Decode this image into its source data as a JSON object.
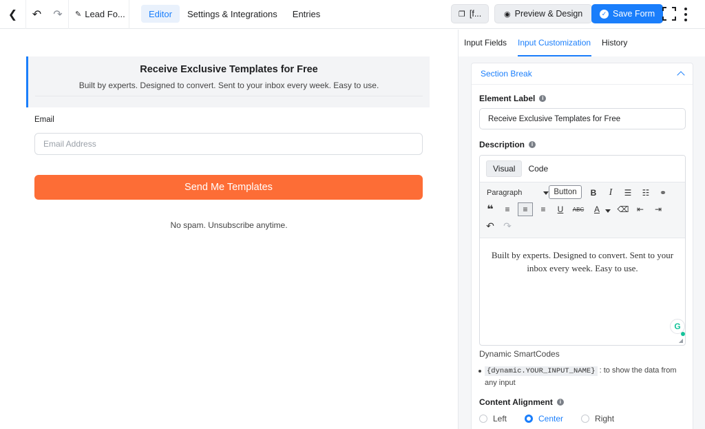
{
  "topbar": {
    "back_icon": "chevron-left-icon",
    "undo_icon": "undo-icon",
    "redo_icon": "redo-icon",
    "form_title": "Lead Fo...",
    "tabs": [
      "Editor",
      "Settings & Integrations",
      "Entries"
    ],
    "shortcode_label": "[f...",
    "preview_label": "Preview & Design",
    "save_label": "Save Form",
    "accent": "#1a7efb"
  },
  "form": {
    "section_title": "Receive Exclusive Templates for Free",
    "section_description": "Built by experts. Designed to convert. Sent to your inbox every week. Easy to use.",
    "email_label": "Email",
    "email_placeholder": "Email Address",
    "submit_label": "Send Me Templates",
    "submit_color": "#fd6d36",
    "footer_text": "No spam. Unsubscribe anytime."
  },
  "sidebar": {
    "tabs": [
      "Input Fields",
      "Input Customization",
      "History"
    ],
    "panel_title": "Section Break",
    "element_label_title": "Element Label",
    "element_label_value": "Receive Exclusive Templates for Free",
    "description_title": "Description",
    "editor_tabs": [
      "Visual",
      "Code"
    ],
    "format_select": "Paragraph",
    "button_tool": "Button",
    "editor_content": "Built by experts. Designed to convert. Sent to your inbox every week. Easy to use.",
    "smartcodes_title": "Dynamic SmartCodes",
    "smartcode": "{dynamic.YOUR_INPUT_NAME}",
    "smartcode_desc": ": to show the data from any input",
    "alignment_title": "Content Alignment",
    "alignment_options": [
      "Left",
      "Center",
      "Right"
    ],
    "alignment_selected": "Center"
  }
}
